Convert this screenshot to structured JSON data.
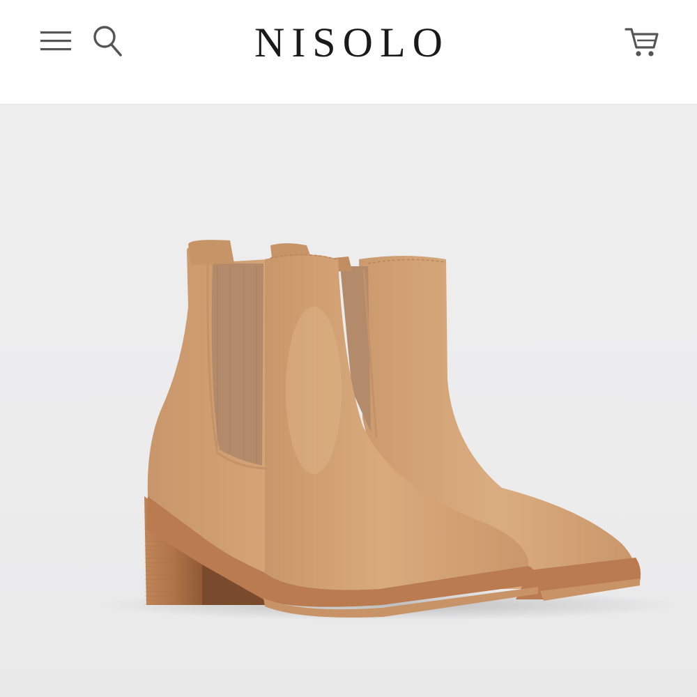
{
  "header": {
    "brand": "NISOLO",
    "menu_icon": "hamburger-menu-icon",
    "search_icon": "search-icon",
    "cart_icon": "shopping-cart-icon"
  },
  "hero": {
    "image_subject": "product-image-chelsea-boots",
    "colors": {
      "leather": "#D3A476",
      "leather_shade": "#B9865A",
      "elastic": "#B38B6B",
      "heel_wood": "#B57A50",
      "sole": "#C99368",
      "background": "#EDEDEE"
    }
  }
}
